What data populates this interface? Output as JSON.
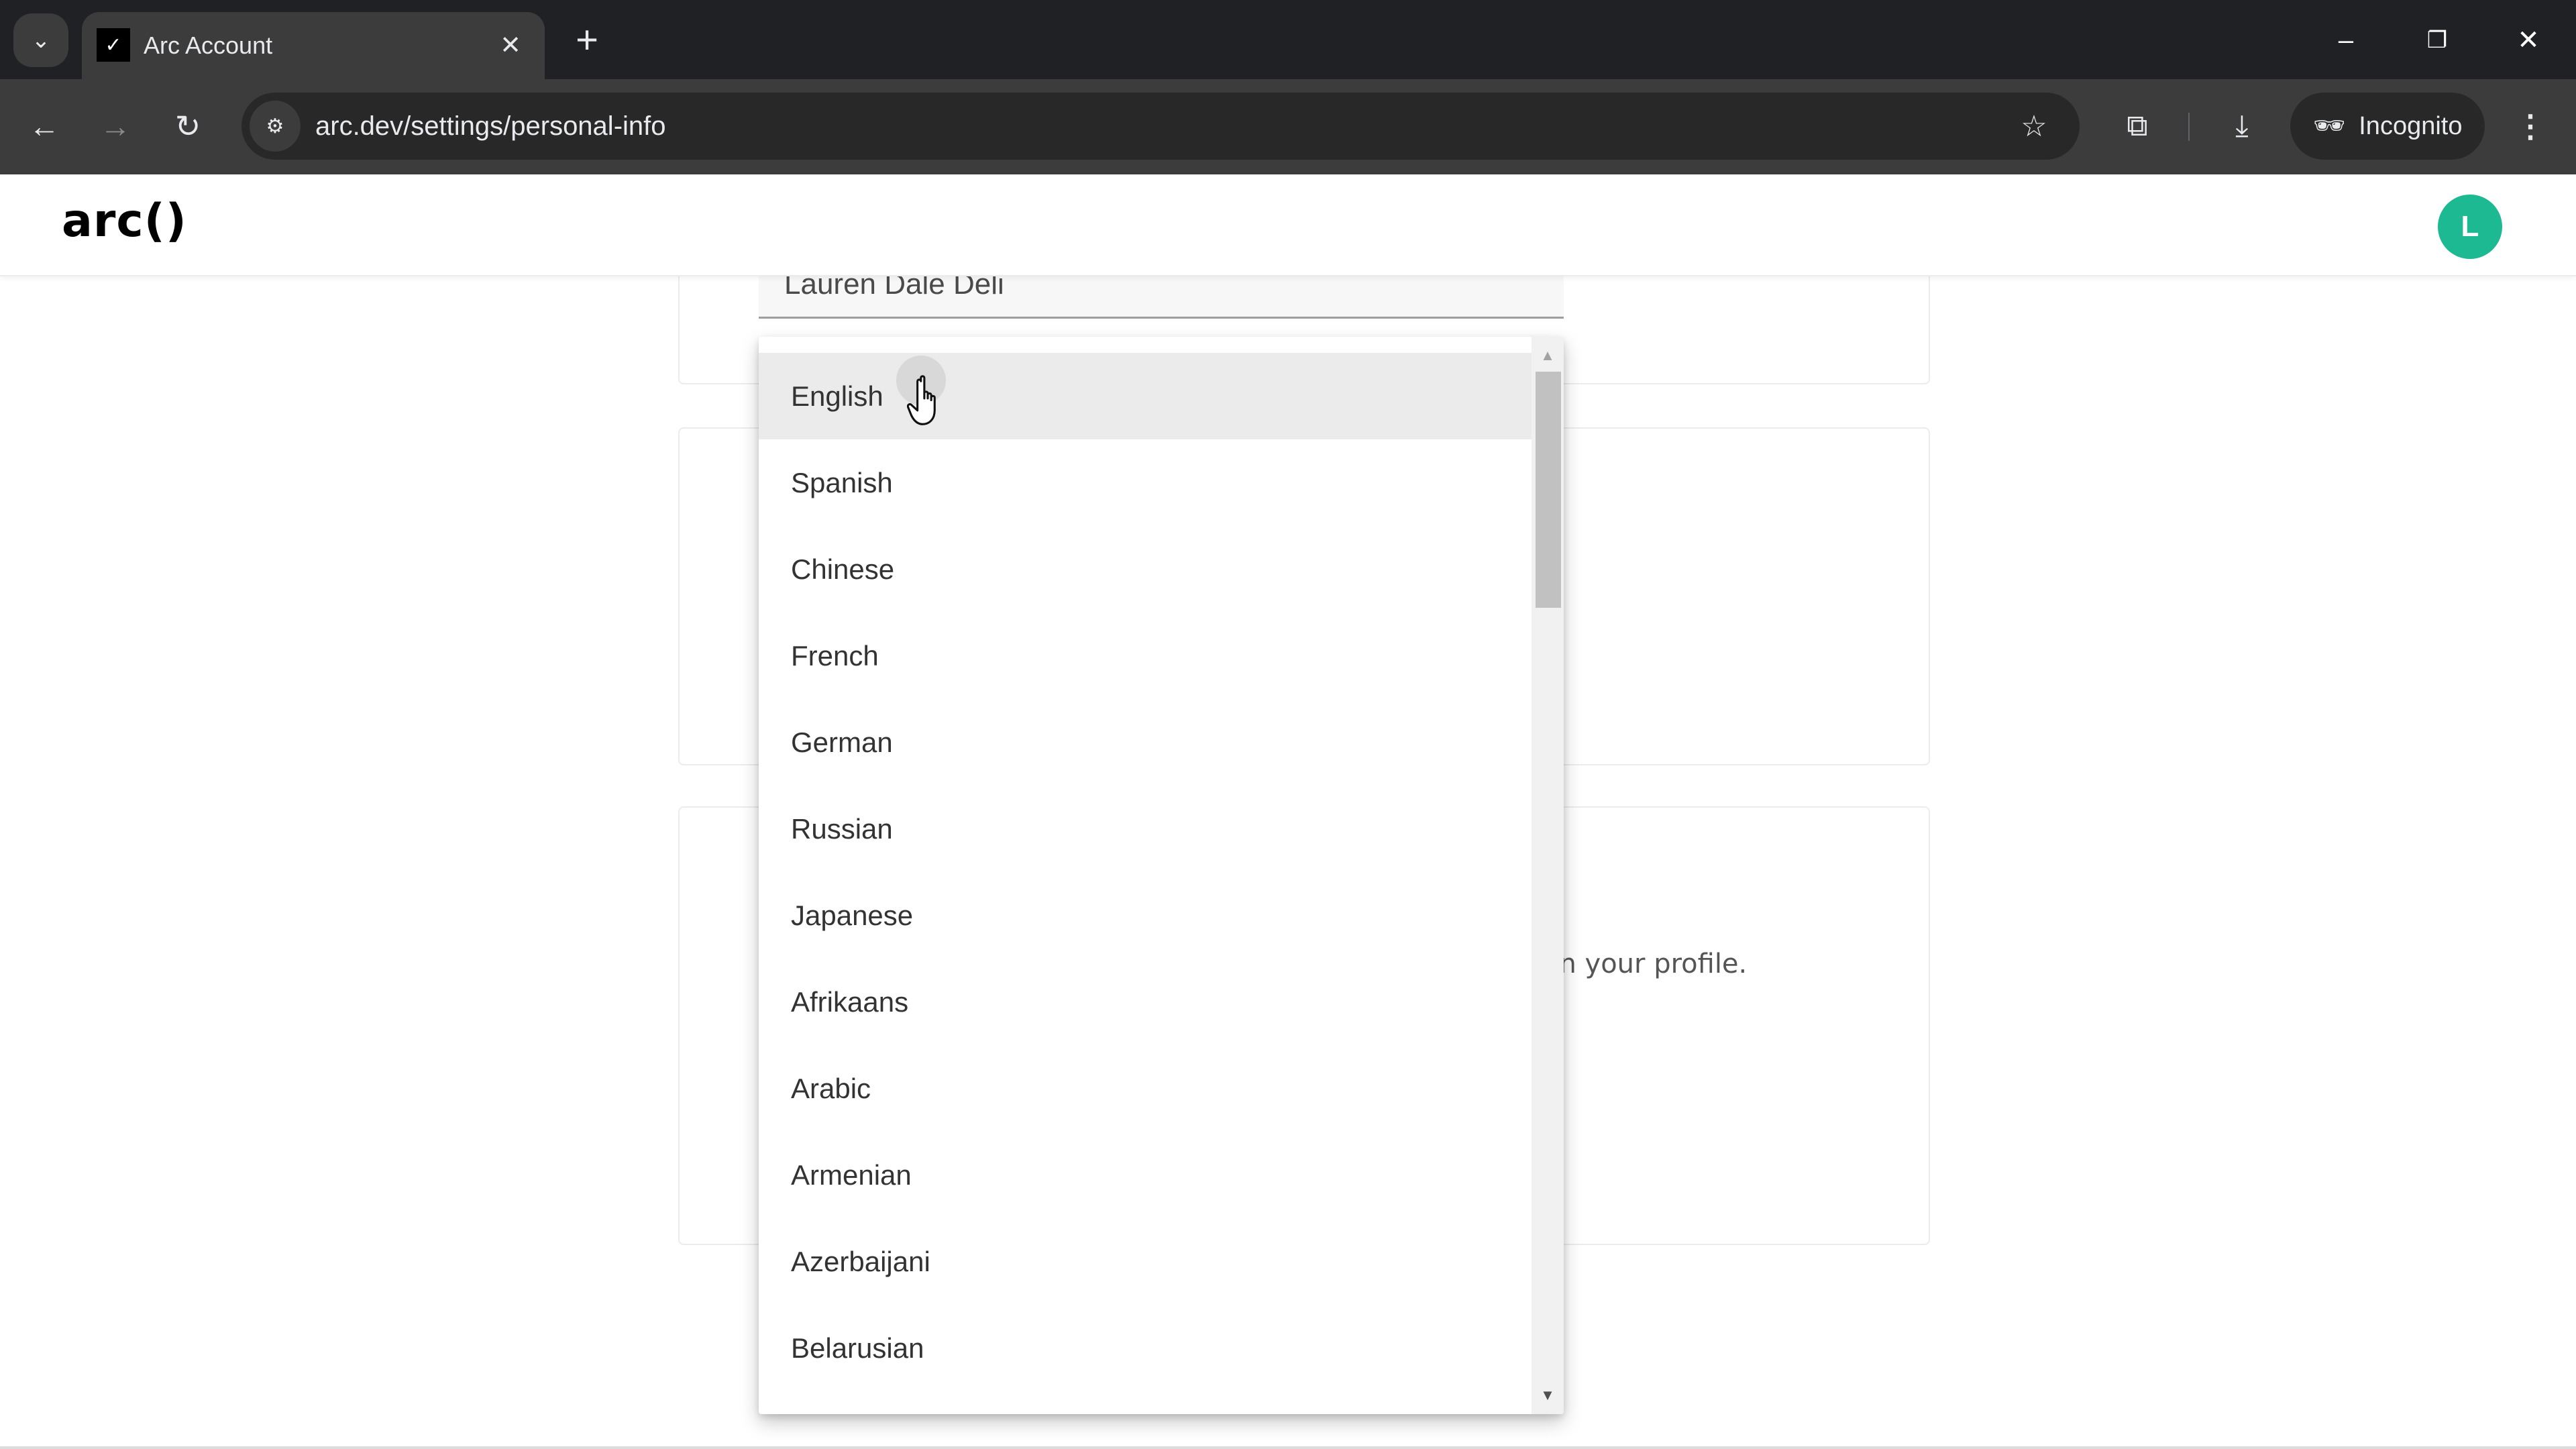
{
  "browser": {
    "tab_search_icon": "chevron-down",
    "tab": {
      "title": "Arc Account",
      "close_glyph": "✕"
    },
    "new_tab_glyph": "+",
    "window_controls": {
      "minimize": "–",
      "restore": "❐",
      "close": "✕"
    },
    "nav": {
      "back": "←",
      "forward": "→",
      "reload": "↻"
    },
    "url": "arc.dev/settings/personal-info",
    "incognito_label": "Incognito"
  },
  "app": {
    "logo": "arc()",
    "avatar_initial": "L",
    "colors": {
      "avatar": "#1db992",
      "highlight": "#ebebeb"
    }
  },
  "form": {
    "name_value": "Lauren Dale Deli",
    "profile_text_fragment": "on your profile."
  },
  "language_dropdown": {
    "hovered_index": 0,
    "options": [
      "English",
      "Spanish",
      "Chinese",
      "French",
      "German",
      "Russian",
      "Japanese",
      "Afrikaans",
      "Arabic",
      "Armenian",
      "Azerbaijani",
      "Belarusian"
    ],
    "scroll_up_glyph": "▲",
    "scroll_down_glyph": "▼"
  }
}
